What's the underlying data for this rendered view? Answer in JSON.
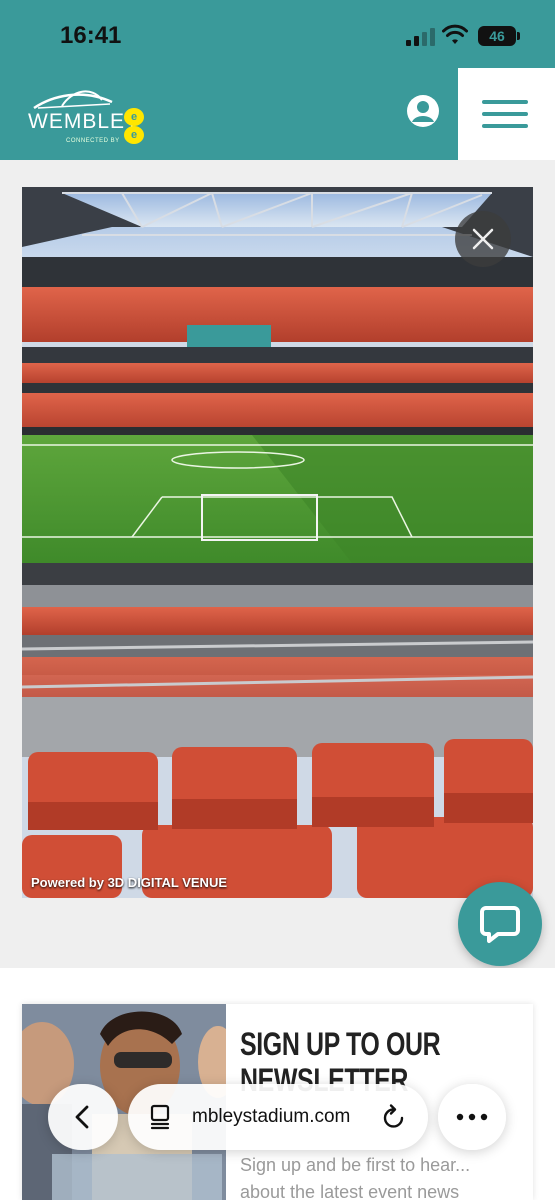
{
  "status_bar": {
    "time": "16:41",
    "battery": "46"
  },
  "header": {
    "logo_text": "WEMBLEY",
    "logo_sub": "CONNECTED BY",
    "ee_text": "EE",
    "account_icon": "account-icon",
    "menu_icon": "hamburger-menu-icon"
  },
  "stadium_view": {
    "close_icon": "close-icon",
    "credit": "Powered by 3D DIGITAL VENUE"
  },
  "chat": {
    "icon": "chat-bubble-icon"
  },
  "newsletter": {
    "title": "SIGN UP TO OUR NEWSLETTER",
    "text": "Sign up and be first to hear... about the latest event news"
  },
  "browser": {
    "url": "mbleystadium.com",
    "back_icon": "chevron-left-icon",
    "tabs_icon": "tabs-icon",
    "reload_icon": "reload-icon",
    "more_icon": "more-icon"
  },
  "colors": {
    "brand_teal": "#3a9a9a",
    "ee_yellow": "#ffe600",
    "seat_red": "#d9543e",
    "pitch_green": "#4e9a32"
  }
}
